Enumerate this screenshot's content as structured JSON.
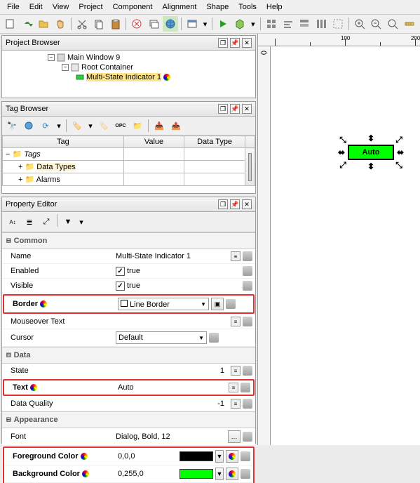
{
  "menu": {
    "file": "File",
    "edit": "Edit",
    "view": "View",
    "project": "Project",
    "component": "Component",
    "alignment": "Alignment",
    "shape": "Shape",
    "tools": "Tools",
    "help": "Help"
  },
  "panels": {
    "projectBrowser": "Project Browser",
    "tagBrowser": "Tag Browser",
    "propertyEditor": "Property Editor"
  },
  "projectTree": {
    "mainWindow": "Main Window 9",
    "rootContainer": "Root Container",
    "multiState": "Multi-State Indicator 1"
  },
  "tagTable": {
    "cols": {
      "tag": "Tag",
      "value": "Value",
      "dataType": "Data Type"
    },
    "rows": {
      "tags": "Tags",
      "dataTypes": "Data Types",
      "alarms": "Alarms"
    }
  },
  "propGroups": {
    "common": "Common",
    "data": "Data",
    "appearance": "Appearance"
  },
  "props": {
    "name": {
      "label": "Name",
      "value": "Multi-State Indicator 1"
    },
    "enabled": {
      "label": "Enabled",
      "value": "true"
    },
    "visible": {
      "label": "Visible",
      "value": "true"
    },
    "border": {
      "label": "Border",
      "value": "Line Border"
    },
    "mouseover": {
      "label": "Mouseover Text",
      "value": ""
    },
    "cursor": {
      "label": "Cursor",
      "value": "Default"
    },
    "state": {
      "label": "State",
      "value": "1"
    },
    "text": {
      "label": "Text",
      "value": "Auto"
    },
    "dataQuality": {
      "label": "Data Quality",
      "value": "-1"
    },
    "font": {
      "label": "Font",
      "value": "Dialog, Bold, 12"
    },
    "fg": {
      "label": "Foreground Color",
      "value": "0,0,0",
      "hex": "#000000"
    },
    "bg": {
      "label": "Background Color",
      "value": "0,255,0",
      "hex": "#00ff00"
    }
  },
  "canvas": {
    "indicatorText": "Auto",
    "rulerH": {
      "m1": "100",
      "m2": "200"
    },
    "rulerV": {
      "m0": "0"
    }
  }
}
